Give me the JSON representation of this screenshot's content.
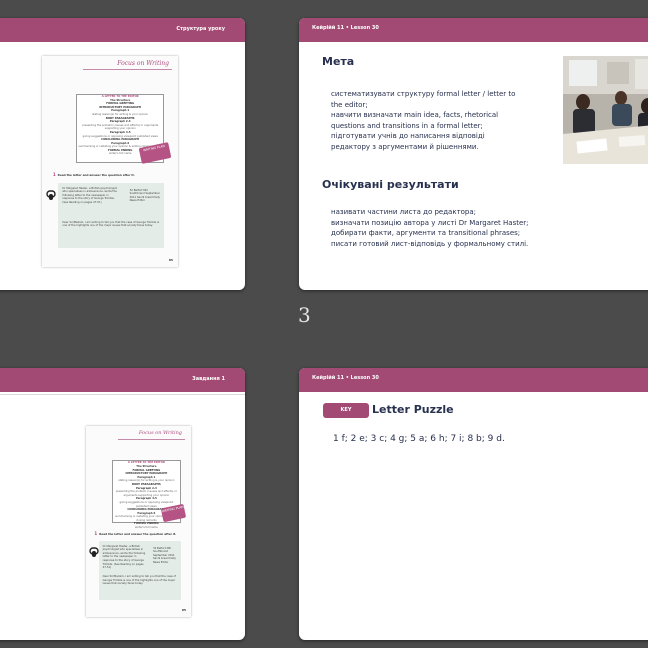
{
  "page_number": "3",
  "slides": [
    {
      "header": "Структура уроку",
      "book": {
        "focus_title": "Focus on Writing",
        "structure_title": "A LETTER TO THE EDITOR",
        "structure_lines": [
          "The Structure",
          "FORMAL GREETING",
          "INTRODUCTORY PARAGRAPH",
          "Paragraph 1",
          "stating reason(s) for writing & your opinion",
          "BODY PARAGRAPHS",
          "Paragraph 2-3",
          "presenting the problem (causes and effects) or arguments supporting your opinion",
          "Paragraph 4-5",
          "giving suggestions or opposing viewpoint published views",
          "CONCLUDING PARAGRAPH",
          "Paragraph 6",
          "summarising or restating your opinion & writing closing remarks",
          "FORMAL ENDING",
          "writer's full name"
        ],
        "tag": "WRITING PLAN",
        "question_num": "1",
        "question": "Read the letter and answer the question after it.",
        "letter_body": "Dr Margaret Haster, a British psychologist who specialises in adolescence, wrote the following letter to the newspaper in response to the story of George Trimble. (See Reading on pages 47-51)",
        "letter_address": "32 Belfort Mill Southbrand September 2011 Sandi bread Daily News Editor",
        "letter_reply": "Dear Sir/Madam, I am writing to tell you that the case of George Trimble is one of the highlights one of the major issues that society faces today.",
        "page": "85"
      }
    },
    {
      "header": "Кейрійй 11 • Lesson 30",
      "goal_title": "Мета",
      "goals": [
        "систематизувати структуру formal letter / letter to",
        "the editor;",
        "навчити визначати main idea, facts, rhetorical",
        "questions and transitions in a formal letter;",
        "підготувати учнів до написання відповіді",
        "редактору з аргументами й рішеннями."
      ],
      "results_title": "Очікувані результати",
      "results": [
        "називати частини листа до редактора;",
        "визначати позицію автора у листі Dr Margaret Haster;",
        "добирати факти, аргументи та transitional phrases;",
        "писати готовий лист-відповідь у формальному стилі."
      ]
    },
    {
      "header": "Завдання 1"
    },
    {
      "header": "Кейрійй 11 • Lesson 30",
      "badge": "KEY",
      "title": "Letter Puzzle",
      "answers": "1 f; 2 e; 3 c; 4 g; 5 a; 6 h; 7 i; 8 b; 9 d."
    }
  ]
}
